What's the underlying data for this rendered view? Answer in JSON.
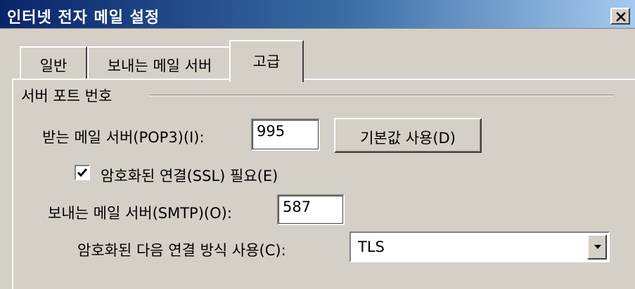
{
  "window": {
    "title": "인터넷 전자 메일 설정",
    "close_glyph": "close-icon"
  },
  "tabs": [
    {
      "label": "일반",
      "active": false
    },
    {
      "label": "보내는 메일 서버",
      "active": false
    },
    {
      "label": "고급",
      "active": true
    }
  ],
  "ports_group": {
    "title": "서버 포트 번호",
    "incoming": {
      "label": "받는 메일 서버(POP3)(I):",
      "value": "995"
    },
    "default_button": "기본값 사용(D)",
    "ssl": {
      "label": "암호화된 연결(SSL) 필요(E)",
      "checked": true
    },
    "outgoing": {
      "label": "보내는 메일 서버(SMTP)(O):",
      "value": "587"
    },
    "encryption": {
      "label": "암호화된 다음 연결 방식 사용(C):",
      "value": "TLS"
    }
  }
}
